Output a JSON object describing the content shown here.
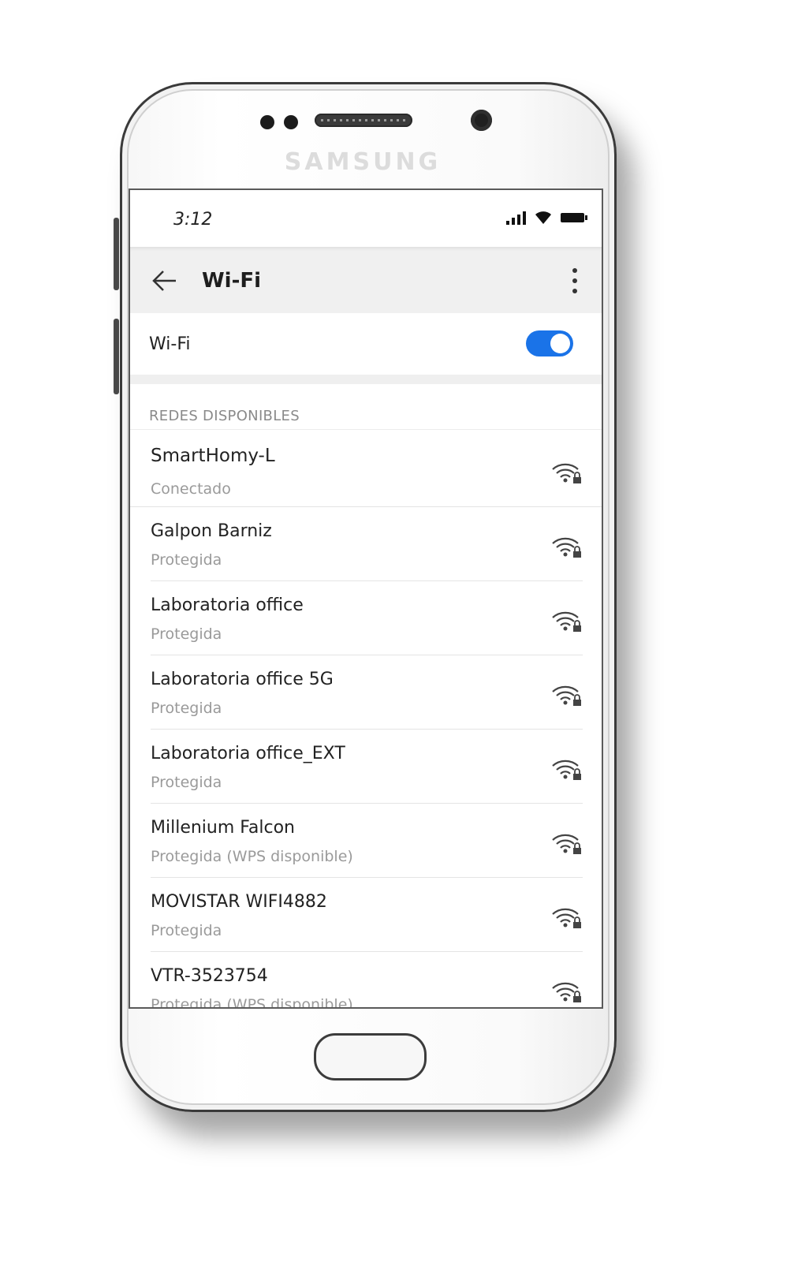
{
  "device": {
    "brand": "SAMSUNG"
  },
  "status_bar": {
    "time": "3:12",
    "icons": [
      "signal-icon",
      "wifi-icon",
      "battery-icon"
    ]
  },
  "app_bar": {
    "title": "Wi-Fi",
    "back_icon": "arrow-left-icon",
    "menu_icon": "more-vertical-icon"
  },
  "wifi_toggle": {
    "label": "Wi-Fi",
    "state": "on",
    "color": "#1a73e8"
  },
  "section": {
    "header": "REDES DISPONIBLES"
  },
  "networks": [
    {
      "name": "SmartHomy-L",
      "status": "Conectado",
      "icon": "wifi-lock-icon"
    },
    {
      "name": "Galpon Barniz",
      "status": "Protegida",
      "icon": "wifi-lock-icon"
    },
    {
      "name": "Laboratoria office",
      "status": "Protegida",
      "icon": "wifi-lock-icon"
    },
    {
      "name": "Laboratoria office 5G",
      "status": "Protegida",
      "icon": "wifi-lock-icon"
    },
    {
      "name": "Laboratoria office_EXT",
      "status": "Protegida",
      "icon": "wifi-lock-icon"
    },
    {
      "name": "Millenium Falcon",
      "status": "Protegida (WPS disponible)",
      "icon": "wifi-lock-icon"
    },
    {
      "name": "MOVISTAR WIFI4882",
      "status": "Protegida",
      "icon": "wifi-lock-icon"
    },
    {
      "name": "VTR-3523754",
      "status": "Protegida (WPS disponible)",
      "icon": "wifi-lock-icon"
    }
  ]
}
